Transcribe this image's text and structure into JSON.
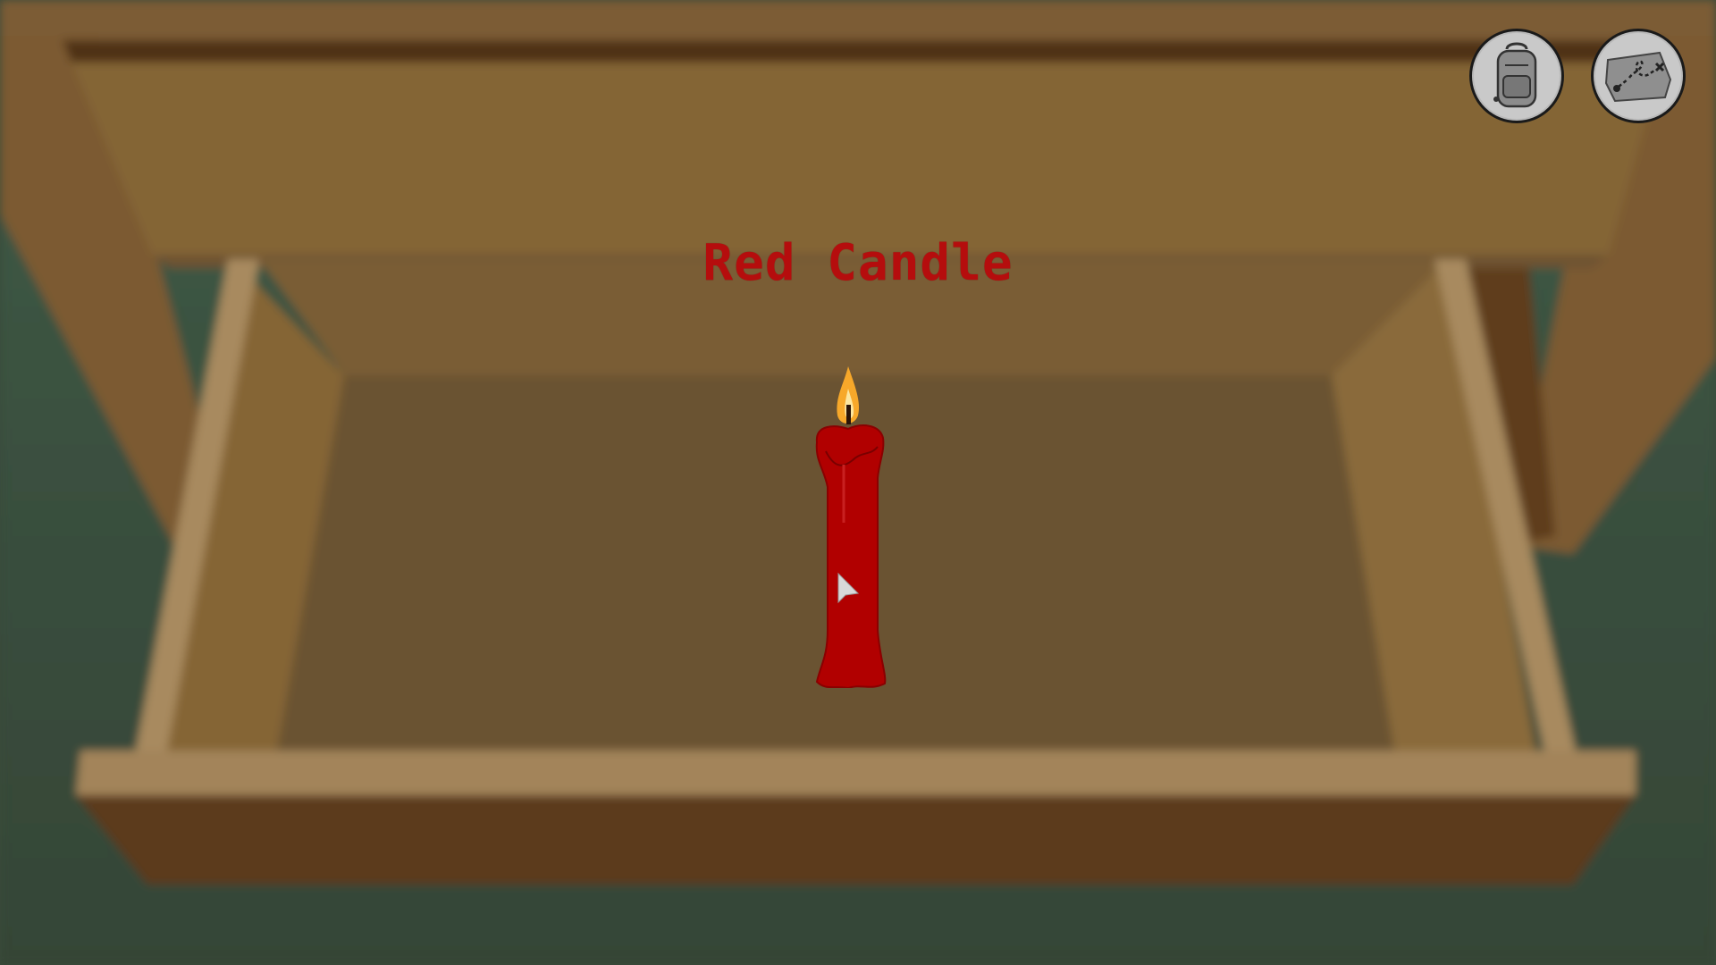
{
  "item": {
    "name": "Red Candle",
    "name_color": "#b50d0d"
  },
  "hud": {
    "buttons": [
      {
        "icon": "backpack-icon"
      },
      {
        "icon": "map-icon"
      }
    ]
  },
  "colors": {
    "wood_light": "#9a7b52",
    "wood_mid": "#846639",
    "wood_dark": "#5d3b1f",
    "drawer_floor": "#6b5331",
    "floor_green": "#3f5543",
    "candle_red": "#b10000",
    "flame_yellow": "#f7a82a"
  }
}
